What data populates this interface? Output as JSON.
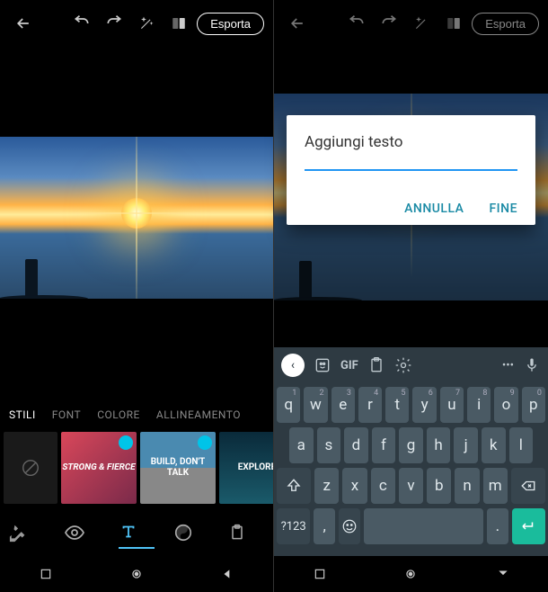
{
  "left": {
    "toolbar": {
      "export": "Esporta"
    },
    "tabs": {
      "styles": "STILI",
      "font": "FONT",
      "color": "COLORE",
      "alignment": "ALLINEAMENTO"
    },
    "style_tiles": [
      {
        "label": ""
      },
      {
        "label": "STRONG & FIERCE",
        "premium": true
      },
      {
        "label": "BUILD, DON'T TALK",
        "premium": true
      },
      {
        "label": "EXPLORE",
        "premium": false
      }
    ]
  },
  "right": {
    "toolbar": {
      "export": "Esporta"
    },
    "dialog": {
      "title": "Aggiungi testo",
      "cancel": "ANNULLA",
      "done": "FINE"
    },
    "keyboard": {
      "topbar": {
        "gif": "GIF"
      },
      "row1": [
        "q",
        "w",
        "e",
        "r",
        "t",
        "y",
        "u",
        "i",
        "o",
        "p"
      ],
      "row1_super": [
        "1",
        "2",
        "3",
        "4",
        "5",
        "6",
        "7",
        "8",
        "9",
        "0"
      ],
      "row2": [
        "a",
        "s",
        "d",
        "f",
        "g",
        "h",
        "j",
        "k",
        "l"
      ],
      "row3": [
        "z",
        "x",
        "c",
        "v",
        "b",
        "n",
        "m"
      ],
      "row4": {
        "symbols": "?123",
        "comma": ",",
        "period": "."
      }
    }
  }
}
